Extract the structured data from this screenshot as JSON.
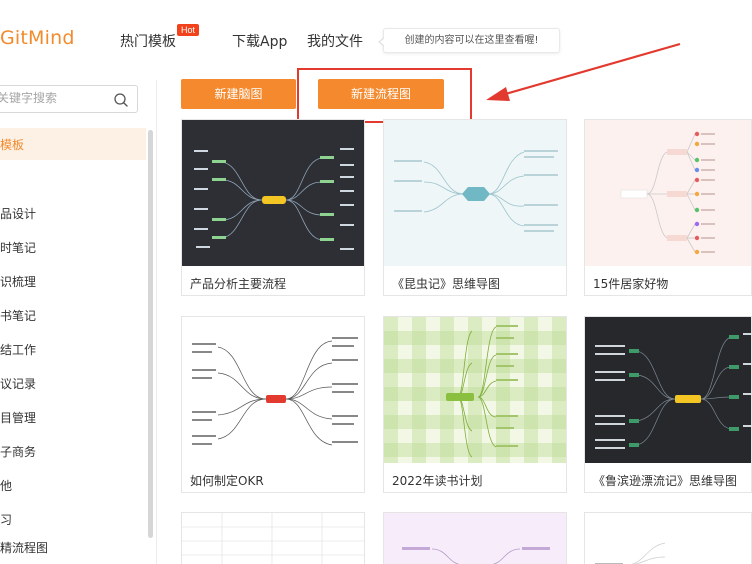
{
  "header": {
    "logo": "GitMind",
    "nav": {
      "hot_templates": "热门模板",
      "hot_badge": "Hot",
      "download_app": "下载App",
      "my_files": "我的文件"
    },
    "tooltip": "创建的内容可以在这里查看喔!"
  },
  "sidebar": {
    "search_placeholder": "关键字搜索",
    "active_item": "模板",
    "items": [
      "品设计",
      "时笔记",
      "识梳理",
      "书笔记",
      "结工作",
      "议记录",
      "目管理",
      "子商务",
      "他",
      "习",
      "精流程图"
    ]
  },
  "actions": {
    "new_mindmap": "新建脑图",
    "new_flowchart": "新建流程图"
  },
  "templates": [
    {
      "title": "产品分析主要流程"
    },
    {
      "title": "《昆虫记》思维导图"
    },
    {
      "title": "15件居家好物"
    },
    {
      "title": "如何制定OKR"
    },
    {
      "title": "2022年读书计划"
    },
    {
      "title": "《鲁滨逊漂流记》思维导图"
    }
  ],
  "colors": {
    "accent": "#f48a2d",
    "annotation_red": "#e23a2e",
    "hot_badge": "#f2421b"
  }
}
